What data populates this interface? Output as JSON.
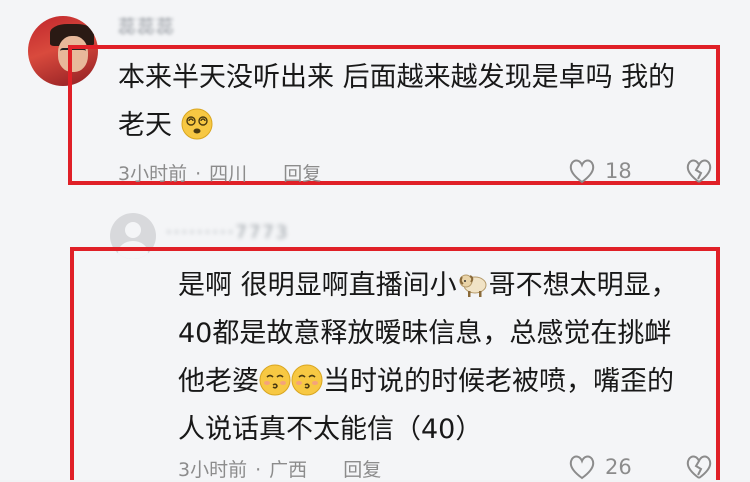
{
  "comment1": {
    "username": "蕊蕊蕊",
    "text_line1": "本来半天没听出来 后面越来越发现是卓吗 我的",
    "text_line2": "老天",
    "emoji_name": "dizzy-face-emoji",
    "time": "3小时前",
    "dot": "·",
    "location": "四川",
    "reply": "回复",
    "likes": "18"
  },
  "comment2": {
    "username": "·········7773",
    "line1_a": "是啊 很明显啊直播间小",
    "line1_emoji": "sheep-emoji",
    "line1_b": "哥不想太明显，",
    "line2": "40都是故意释放暧昧信息，总感觉在挑衅",
    "line3_a": "他老婆",
    "line3_emoji": "kissing-face-emoji",
    "line3_b": "当时说的时候老被喷，嘴歪的",
    "line4": "人说话真不太能信（40）",
    "time": "3小时前",
    "dot": "·",
    "location": "广西",
    "reply": "回复",
    "likes": "26"
  },
  "colors": {
    "highlight": "#e02027",
    "meta": "#8c8c8c",
    "text": "#181818",
    "background": "#f4f5f7"
  }
}
